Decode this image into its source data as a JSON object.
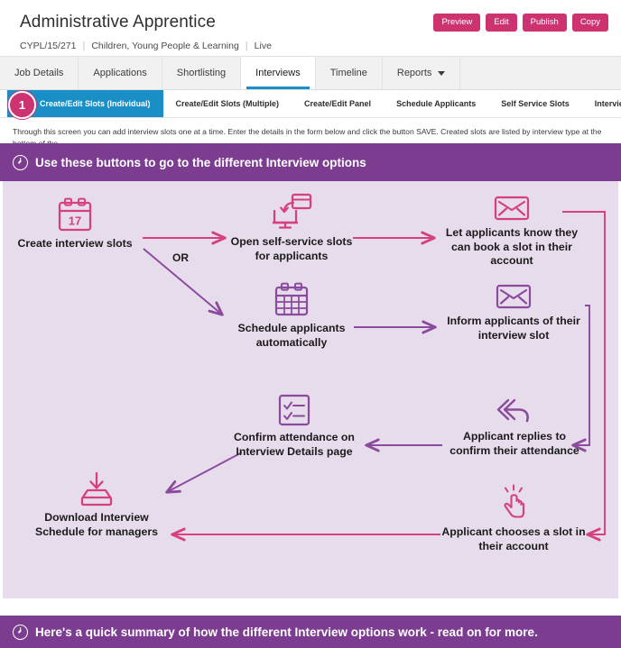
{
  "header": {
    "job_title": "Administrative Apprentice",
    "reference": "CYPL/15/271",
    "department": "Children, Young People & Learning",
    "status": "Live",
    "separator": "|",
    "buttons": [
      {
        "label": "Preview",
        "name": "preview-button"
      },
      {
        "label": "Edit",
        "name": "edit-button"
      },
      {
        "label": "Publish",
        "name": "publish-button"
      },
      {
        "label": "Copy",
        "name": "copy-button"
      }
    ]
  },
  "tabs": [
    {
      "label": "Job Details",
      "active": false,
      "caret": false
    },
    {
      "label": "Applications",
      "active": false,
      "caret": false
    },
    {
      "label": "Shortlisting",
      "active": false,
      "caret": false
    },
    {
      "label": "Interviews",
      "active": true,
      "caret": false
    },
    {
      "label": "Timeline",
      "active": false,
      "caret": false
    },
    {
      "label": "Reports",
      "active": false,
      "caret": true
    }
  ],
  "subtabs": [
    {
      "label": "Create/Edit Slots (Individual)",
      "active": true
    },
    {
      "label": "Create/Edit Slots (Multiple)",
      "active": false
    },
    {
      "label": "Create/Edit Panel",
      "active": false
    },
    {
      "label": "Schedule Applicants",
      "active": false
    },
    {
      "label": "Self Service Slots",
      "active": false
    },
    {
      "label": "Interview Details",
      "active": false
    }
  ],
  "badge": {
    "number": "1"
  },
  "blurb": "Through this screen you can add interview slots one at a time. Enter the details in the form below and click the button SAVE. Created slots are listed by interview type at the bottom of the",
  "callouts": {
    "top": "Use these buttons to go to the different Interview options",
    "bottom": "Here's a quick summary of how the different Interview options work - read on for more."
  },
  "diagram": {
    "or_label": "OR",
    "nodes": [
      {
        "id": "create-slots",
        "label": "Create interview slots",
        "icon": "calendar-17-icon",
        "color": "#d6407f"
      },
      {
        "id": "open-self-service",
        "label": "Open self-service slots for applicants",
        "icon": "monitor-window-icon",
        "color": "#d6407f"
      },
      {
        "id": "let-applicants-know",
        "label": "Let applicants know they can book a slot in their account",
        "icon": "envelope-icon",
        "color": "#d6407f"
      },
      {
        "id": "schedule-applicants",
        "label": "Schedule applicants automatically",
        "icon": "calendar-grid-icon",
        "color": "#8b4a9e"
      },
      {
        "id": "inform-applicants",
        "label": "Inform applicants of their interview slot",
        "icon": "envelope-icon",
        "color": "#8b4a9e"
      },
      {
        "id": "applicant-replies",
        "label": "Applicant replies to confirm their attendance",
        "icon": "reply-arrow-icon",
        "color": "#8b4a9e"
      },
      {
        "id": "confirm-attendance",
        "label": "Confirm attendance on Interview Details page",
        "icon": "checklist-icon",
        "color": "#8b4a9e"
      },
      {
        "id": "applicant-chooses-slot",
        "label": "Applicant chooses a slot in their account",
        "icon": "pointing-hand-icon",
        "color": "#d6407f"
      },
      {
        "id": "download-schedule",
        "label": "Download Interview Schedule for managers",
        "icon": "download-tray-icon",
        "color": "#d6407f"
      }
    ]
  },
  "colors": {
    "pink": "#d6407f",
    "purple": "#8b4a9e",
    "banner_purple": "#7c3d91",
    "button_pink": "#cc3370",
    "tab_blue": "#1a8fc7",
    "diagram_bg": "#e6dceb"
  }
}
